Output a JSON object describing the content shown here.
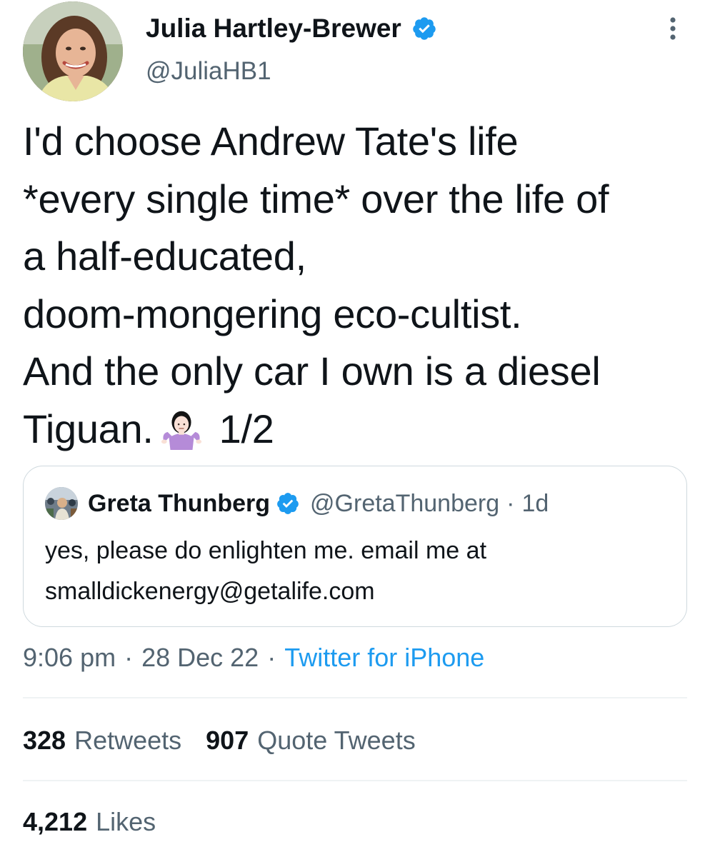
{
  "author": {
    "display_name": "Julia Hartley-Brewer",
    "handle": "@JuliaHB1",
    "verified": true
  },
  "tweet": {
    "text_line_1": "I'd choose Andrew Tate's life",
    "text_line_2": "*every single time* over the life of",
    "text_line_3": "a half-educated,",
    "text_line_4": "doom-mongering eco-cultist.",
    "text_line_5": "And the only car I own is a diesel",
    "text_line_6_start": "Tiguan.",
    "emoji": "person-shrugging-emoji",
    "text_line_6_end": "1/2"
  },
  "quoted_tweet": {
    "display_name": "Greta Thunberg",
    "handle": "@GretaThunberg",
    "separator": "·",
    "time": "1d",
    "text_line_1": "yes, please do enlighten me. email me at",
    "text_line_2": "smalldickenergy@getalife.com"
  },
  "meta": {
    "time": "9:06 pm",
    "separator": "·",
    "date": "28 Dec 22",
    "source": "Twitter for iPhone"
  },
  "stats": {
    "retweets_count": "328",
    "retweets_label": "Retweets",
    "quote_tweets_count": "907",
    "quote_tweets_label": "Quote Tweets",
    "likes_count": "4,212",
    "likes_label": "Likes"
  },
  "colors": {
    "text_primary": "#0f1419",
    "text_secondary": "#536471",
    "link_blue": "#1d9bf0",
    "border": "#cfd9de",
    "divider": "#eff3f4"
  }
}
